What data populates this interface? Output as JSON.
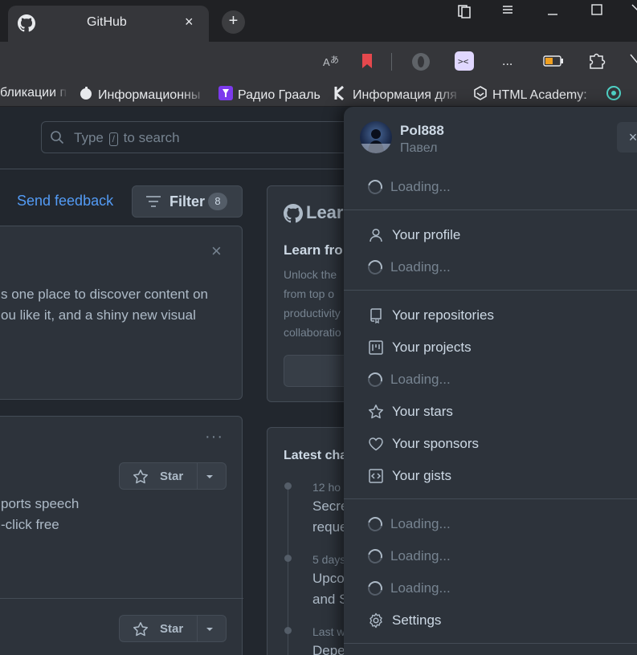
{
  "browser": {
    "tab_title": "GitHub",
    "tab_close": "×",
    "new_tab": "+",
    "toolbar_more": "...",
    "bookmarks": [
      "бликации п",
      "Информационны",
      "Радио Грааль",
      "Информация для",
      "HTML Academy: "
    ]
  },
  "search": {
    "prefix": "Type",
    "key": "/",
    "suffix": "to search"
  },
  "feed": {
    "send_feedback": "Send feedback",
    "filter_label": "Filter",
    "filter_count": "8",
    "intro_close": "×",
    "intro_lines": [
      "s one place to discover content on",
      "ou like it, and a shiny new visual"
    ],
    "repo_more": "···",
    "repo_lines": [
      "ports speech",
      "-click free"
    ],
    "star_label": "Star",
    "star_label_2": "Star"
  },
  "learn": {
    "title": "Lear",
    "subtitle": "Learn fro",
    "lines": [
      "Unlock the",
      "from top o",
      "productivity",
      "collaboratio"
    ]
  },
  "changelog": {
    "title": "Latest cha",
    "entries": [
      {
        "time": "12 ho",
        "line1": "Secre",
        "line2": "reque"
      },
      {
        "time": "5 days",
        "line1": "Upco",
        "line2": "and S"
      },
      {
        "time": "Last w",
        "line1": "Depe",
        "line2": ""
      }
    ]
  },
  "user_menu": {
    "username": "Pol888",
    "real_name": "Павел",
    "close": "×",
    "loading": "Loading...",
    "items": {
      "profile": "Your profile",
      "repositories": "Your repositories",
      "projects": "Your projects",
      "stars": "Your stars",
      "sponsors": "Your sponsors",
      "gists": "Your gists",
      "settings": "Settings"
    }
  },
  "colors": {
    "accent": "#539bf5",
    "bookmark_red": "#e5484d",
    "battery": "#f0a020"
  }
}
